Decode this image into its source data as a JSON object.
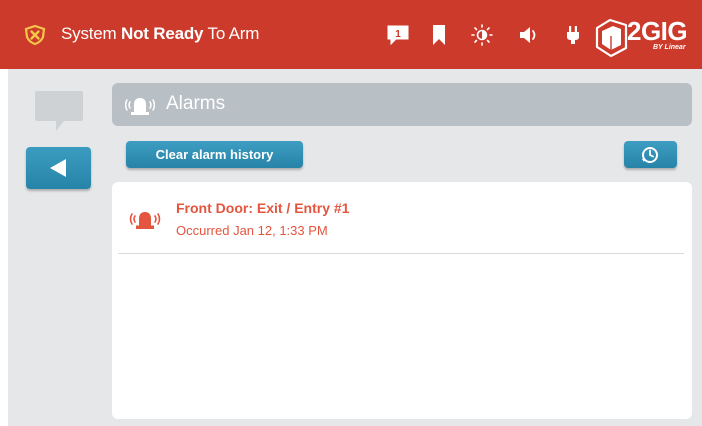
{
  "status_bar": {
    "status_prefix": "System ",
    "status_bold": "Not Ready",
    "status_suffix": " To Arm",
    "message_count": "1",
    "brand_name": "2GIG",
    "brand_sub": "BY Linear",
    "icons": [
      "shield-x-icon",
      "message-icon",
      "bookmark-icon",
      "brightness-icon",
      "volume-icon",
      "power-plug-icon",
      "cube-logo-icon"
    ],
    "colors": {
      "bar": "#cc3a2b",
      "accent_blue": "#2b8ab0",
      "alarm_text": "#e4553f"
    }
  },
  "page": {
    "title": "Alarms",
    "title_icon": "siren-icon"
  },
  "actions": {
    "clear_label": "Clear alarm history",
    "history_icon": "history-clock-icon",
    "back_icon": "back-arrow-icon"
  },
  "alarms": [
    {
      "title": "Front Door: Exit / Entry #1",
      "occurred": "Occurred Jan 12, 1:33 PM",
      "icon": "siren-icon"
    }
  ]
}
